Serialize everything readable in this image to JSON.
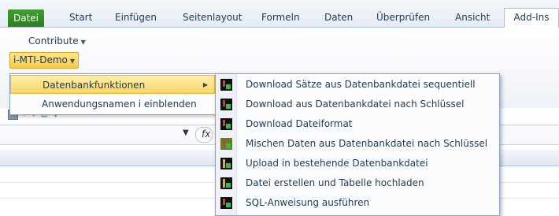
{
  "ribbon_tabs": [
    "Datei",
    "Start",
    "Einfügen",
    "Seitenlayout",
    "Formeln",
    "Daten",
    "Überprüfen",
    "Ansicht",
    "Add-Ins"
  ],
  "ribbon": {
    "contribute_label": "Contribute",
    "imti_label": "i-MTI-Demo"
  },
  "menu": {
    "items": [
      "Datenbankfunktionen",
      "Anwendungsnamen i einblenden"
    ]
  },
  "submenu": {
    "items": [
      "Download Sätze aus Datenbankdatei sequentiell",
      "Download aus Datenbankdatei nach Schlüssel",
      "Download Dateiformat",
      "Mischen Daten aus Datenbankdatei nach Schlüssel",
      "Upload in bestehende Datenbankdatei",
      "Datei erstellen und Tabelle hochladen",
      "SQL-Anweisung ausführen"
    ]
  },
  "formula_bar": {
    "fx": "fx"
  },
  "colors": {
    "file_tab": "#2a7f1d",
    "hover_yellow": "#f9d769",
    "menu_border": "#8aa3c2"
  }
}
